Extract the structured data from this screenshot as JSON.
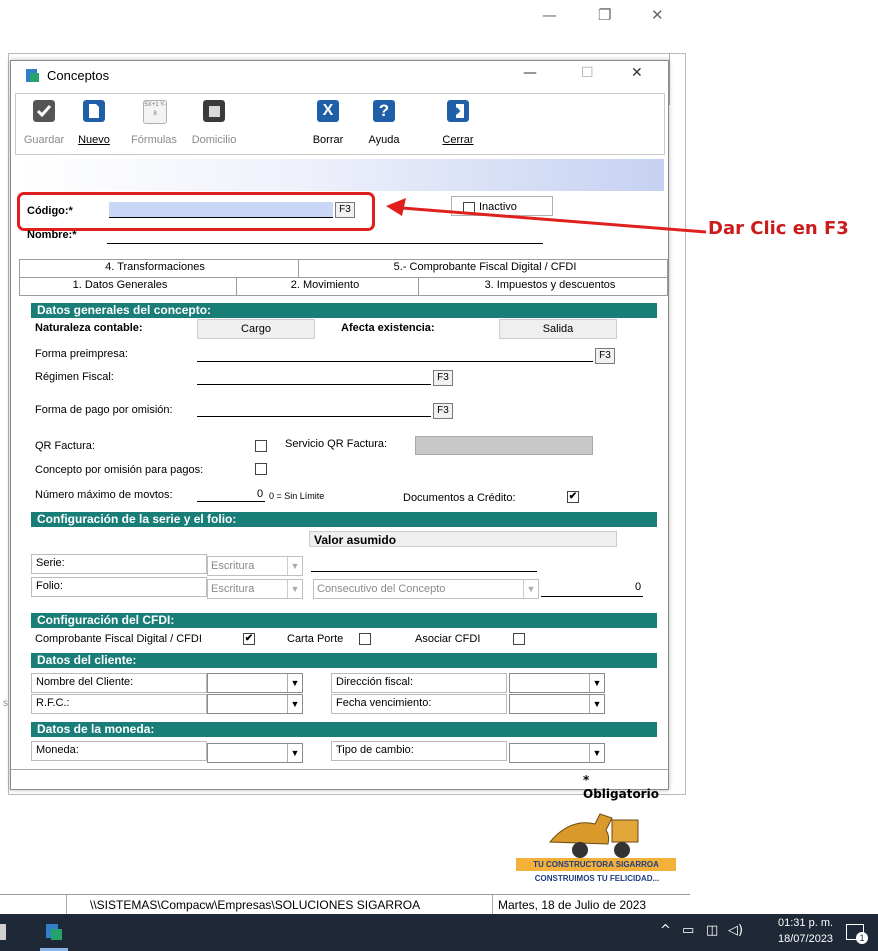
{
  "outer_window": {
    "minimize": "—",
    "restore": "❐",
    "close": "✕"
  },
  "dialog": {
    "title": "Conceptos",
    "title_icon": "conceptos-app-icon",
    "controls": {
      "minimize": "—",
      "maximize": "☐",
      "close": "✕"
    }
  },
  "toolbar": {
    "guardar": "Guardar",
    "nuevo": "Nuevo",
    "formulas": "Fórmulas",
    "formulas_icon_text": "5X+1 Y-8",
    "domicilio": "Domicilio",
    "borrar": "Borrar",
    "borrar_icon": "X",
    "ayuda": "Ayuda",
    "ayuda_icon": "?",
    "cerrar": "Cerrar"
  },
  "header": {
    "codigo_label": "Código:*",
    "codigo_value": "",
    "f3": "F3",
    "nombre_label": "Nombre:*",
    "nombre_value": "",
    "inactivo_label": "Inactivo"
  },
  "tabs": {
    "row1": [
      "4. Transformaciones",
      "5.- Comprobante Fiscal Digital / CFDI"
    ],
    "row2": [
      "1. Datos Generales",
      "2. Movimiento",
      "3. Impuestos y descuentos"
    ]
  },
  "datos_generales": {
    "section_title": "Datos generales del concepto:",
    "naturaleza_label": "Naturaleza contable:",
    "naturaleza_value": "Cargo",
    "afecta_label": "Afecta existencia:",
    "afecta_value": "Salida",
    "forma_preimpresa": "Forma preimpresa:",
    "regimen_fiscal": "Régimen Fiscal:",
    "forma_pago": "Forma de pago por omisión:",
    "f3": "F3",
    "qr_factura": "QR Factura:",
    "servicio_qr": "Servicio QR Factura:",
    "concepto_omision": "Concepto por omisión para pagos:",
    "numero_maximo": "Número máximo de movtos:",
    "numero_value": "0",
    "sin_limite": "0 = Sin Límite",
    "documentos_credito": "Documentos a Crédito:",
    "documentos_check": "✔"
  },
  "serie_folio": {
    "section_title": "Configuración de la serie y el folio:",
    "valor_asumido": "Valor asumido",
    "serie_label": "Serie:",
    "folio_label": "Folio:",
    "escritura": "Escritura",
    "consecutivo": "Consecutivo del Concepto",
    "folio_value": "0"
  },
  "cfdi": {
    "section_title": "Configuración del CFDI:",
    "comprobante_label": "Comprobante Fiscal Digital / CFDI",
    "comprobante_check": "✔",
    "carta_porte": "Carta Porte",
    "asociar": "Asociar CFDI"
  },
  "cliente": {
    "section_title": "Datos del cliente:",
    "nombre": "Nombre del Cliente:",
    "rfc": "R.F.C.:",
    "direccion": "Dirección fiscal:",
    "fecha": "Fecha vencimiento:"
  },
  "moneda": {
    "section_title": "Datos de la moneda:",
    "moneda": "Moneda:",
    "tipo_cambio": "Tipo de cambio:"
  },
  "obligatorio": "* Obligatorio",
  "logo": {
    "line1": "TU CONSTRUCTORA SIGARROA",
    "line2": "CONSTRUIMOS TU FELICIDAD..."
  },
  "statusbar": {
    "path": "\\\\SISTEMAS\\Compacw\\Empresas\\SOLUCIONES SIGARROA",
    "date": "Martes, 18 de Julio de 2023"
  },
  "taskbar": {
    "time": "01:31 p. m.",
    "date": "18/07/2023",
    "notif_count": "1"
  },
  "annotation": {
    "text": "Dar Clic en F3",
    "color": "#cc1b1b"
  },
  "side_letter": "s"
}
